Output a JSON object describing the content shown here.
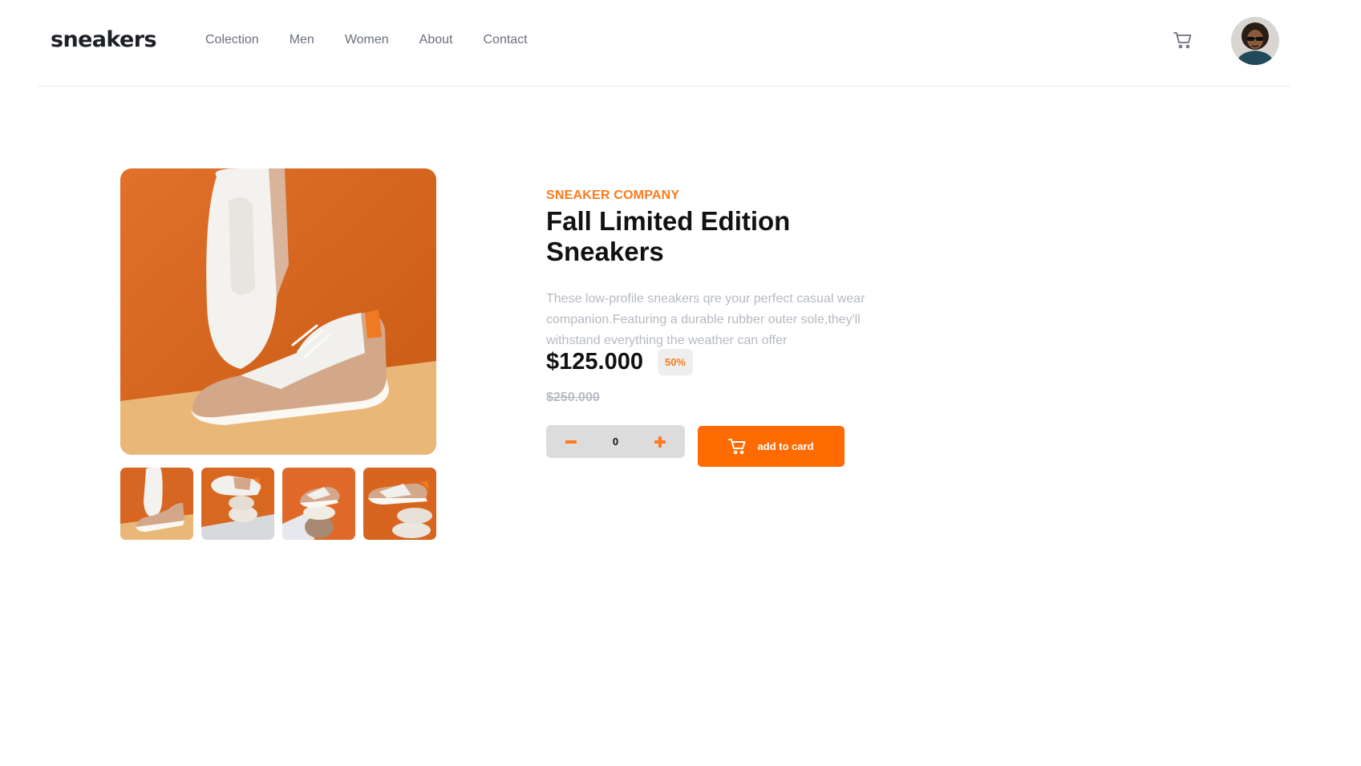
{
  "brand": {
    "logo": "sneakers"
  },
  "nav": [
    {
      "label": "Colection"
    },
    {
      "label": "Men"
    },
    {
      "label": "Women"
    },
    {
      "label": "About"
    },
    {
      "label": "Contact"
    }
  ],
  "header": {
    "cart_icon": "cart-icon",
    "avatar": "user-avatar"
  },
  "product": {
    "company": "SNEAKER COMPANY",
    "title": "Fall Limited Edition Sneakers",
    "description": "These low-profile sneakers qre your perfect casual wear companion.Featuring a durable rubber outer sole,they'll withstand everything the weather can offer",
    "price": "$125.000",
    "discount": "50%",
    "old_price": "$250.000"
  },
  "cart_controls": {
    "minus_icon": "minus-icon",
    "plus_icon": "plus-icon",
    "quantity": "0",
    "add_label": "add to card"
  },
  "colors": {
    "accent": "#ff7a1a",
    "button": "#ff6b00",
    "text": "#1d2026",
    "muted": "#b6bac2"
  }
}
